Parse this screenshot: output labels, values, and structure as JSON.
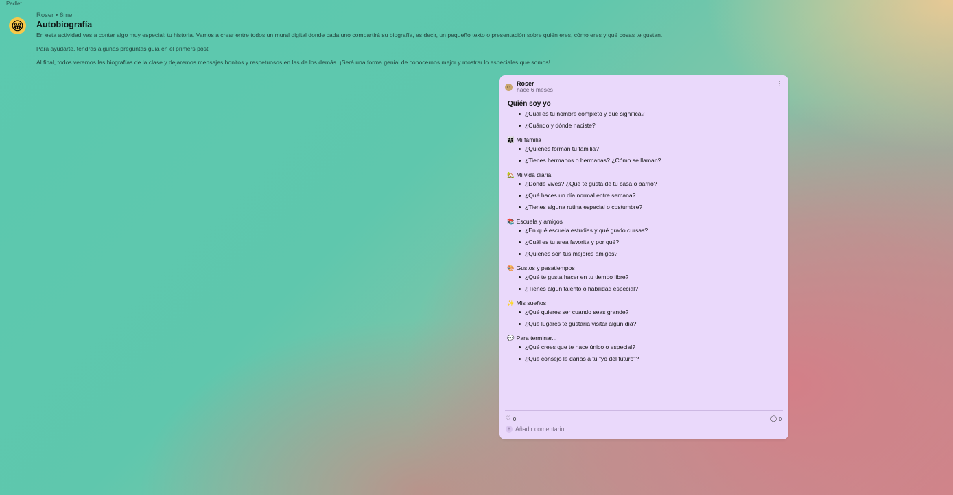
{
  "brand": "Padlet",
  "header": {
    "avatar_icon": "😁",
    "meta": "Roser • 6me",
    "title": "Autobiografía",
    "paragraphs": [
      "En esta actividad vas a contar algo muy especial: tu historia. Vamos a crear entre todos un mural digital donde cada uno compartirá su biografía, es decir, un pequeño texto o presentación sobre quién eres, cómo eres y qué cosas te gustan.",
      "Para ayudarte, tendrás algunas preguntas guía en el primers post.",
      "Al final, todos veremos las biografías de la clase y dejaremos mensajes bonitos y respetuosos en las de los demás. ¡Será una forma genial de conocernos mejor y mostrar lo especiales que somos!"
    ]
  },
  "post": {
    "author": "Roser",
    "time": "hace 6 meses",
    "title": "Quién soy yo",
    "sections": [
      {
        "emoji": "",
        "heading": "",
        "items": [
          "¿Cuál es tu nombre completo y qué significa?",
          "¿Cuándo y dónde naciste?"
        ]
      },
      {
        "emoji": "👨‍👩‍👧",
        "heading": "Mi familia",
        "items": [
          "¿Quiénes forman tu familia?",
          "¿Tienes hermanos o hermanas? ¿Cómo se llaman?"
        ]
      },
      {
        "emoji": "🏡",
        "heading": "Mi vida diaria",
        "items": [
          "¿Dónde vives? ¿Qué te gusta de tu casa o barrio?",
          "¿Qué haces un día normal entre semana?",
          "¿Tienes alguna rutina especial o costumbre?"
        ]
      },
      {
        "emoji": "📚",
        "heading": "Escuela y amigos",
        "items": [
          "¿En qué escuela estudias y qué grado cursas?",
          "¿Cuál es tu area favorita y por qué?",
          "¿Quiénes son tus mejores amigos?"
        ]
      },
      {
        "emoji": "🎨",
        "heading": "Gustos y pasatiempos",
        "items": [
          "¿Qué te gusta hacer en tu tiempo libre?",
          "¿Tienes algún talento o habilidad especial?"
        ]
      },
      {
        "emoji": "✨",
        "heading": "Mis sueños",
        "items": [
          "¿Qué quieres ser cuando seas grande?",
          "¿Qué lugares te gustaría visitar algún día?"
        ]
      },
      {
        "emoji": "💬",
        "heading": "Para terminar...",
        "items": [
          "¿Qué crees que te hace único o especial?",
          "¿Qué consejo le darías a tu \"yo del futuro\"?"
        ]
      }
    ],
    "likes": "0",
    "comments": "0",
    "add_comment": "Añadir comentario"
  }
}
